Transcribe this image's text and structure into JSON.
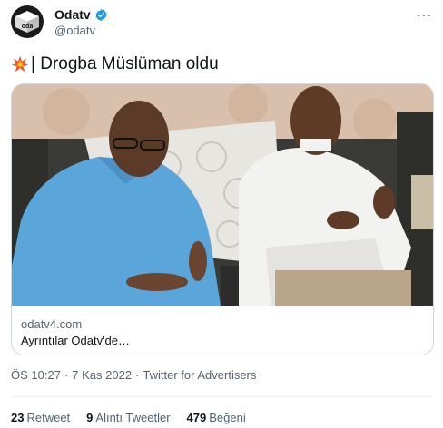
{
  "author": {
    "display_name": "Odatv",
    "handle": "@odatv",
    "logo_text": "oda",
    "verified_icon": "verified-badge-icon",
    "verified_color": "#1d9bf0"
  },
  "more_label": "···",
  "tweet": {
    "emoji": "collision-icon",
    "text": "| Drogba Müslüman oldu"
  },
  "card": {
    "domain": "odatv4.com",
    "title": "Ayrıntılar Odatv'de…"
  },
  "meta": {
    "time": "ÖS 10:27",
    "separator1": "·",
    "date": "7 Kas 2022",
    "separator2": "·",
    "source": "Twitter for Advertisers"
  },
  "stats": {
    "retweets": "23",
    "retweets_label": "Retweet",
    "quotes": "9",
    "quotes_label": "Alıntı Tweetler",
    "likes": "479",
    "likes_label": "Beğeni"
  }
}
